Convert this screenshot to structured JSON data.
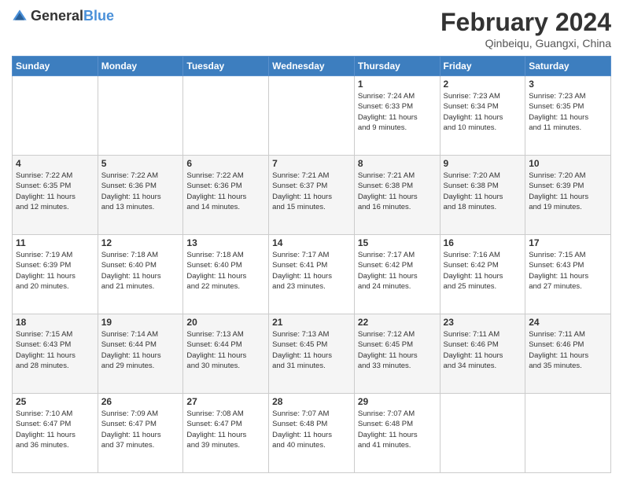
{
  "header": {
    "logo_general": "General",
    "logo_blue": "Blue",
    "month_title": "February 2024",
    "location": "Qinbeiqu, Guangxi, China"
  },
  "weekdays": [
    "Sunday",
    "Monday",
    "Tuesday",
    "Wednesday",
    "Thursday",
    "Friday",
    "Saturday"
  ],
  "weeks": [
    [
      {
        "day": "",
        "info": ""
      },
      {
        "day": "",
        "info": ""
      },
      {
        "day": "",
        "info": ""
      },
      {
        "day": "",
        "info": ""
      },
      {
        "day": "1",
        "info": "Sunrise: 7:24 AM\nSunset: 6:33 PM\nDaylight: 11 hours\nand 9 minutes."
      },
      {
        "day": "2",
        "info": "Sunrise: 7:23 AM\nSunset: 6:34 PM\nDaylight: 11 hours\nand 10 minutes."
      },
      {
        "day": "3",
        "info": "Sunrise: 7:23 AM\nSunset: 6:35 PM\nDaylight: 11 hours\nand 11 minutes."
      }
    ],
    [
      {
        "day": "4",
        "info": "Sunrise: 7:22 AM\nSunset: 6:35 PM\nDaylight: 11 hours\nand 12 minutes."
      },
      {
        "day": "5",
        "info": "Sunrise: 7:22 AM\nSunset: 6:36 PM\nDaylight: 11 hours\nand 13 minutes."
      },
      {
        "day": "6",
        "info": "Sunrise: 7:22 AM\nSunset: 6:36 PM\nDaylight: 11 hours\nand 14 minutes."
      },
      {
        "day": "7",
        "info": "Sunrise: 7:21 AM\nSunset: 6:37 PM\nDaylight: 11 hours\nand 15 minutes."
      },
      {
        "day": "8",
        "info": "Sunrise: 7:21 AM\nSunset: 6:38 PM\nDaylight: 11 hours\nand 16 minutes."
      },
      {
        "day": "9",
        "info": "Sunrise: 7:20 AM\nSunset: 6:38 PM\nDaylight: 11 hours\nand 18 minutes."
      },
      {
        "day": "10",
        "info": "Sunrise: 7:20 AM\nSunset: 6:39 PM\nDaylight: 11 hours\nand 19 minutes."
      }
    ],
    [
      {
        "day": "11",
        "info": "Sunrise: 7:19 AM\nSunset: 6:39 PM\nDaylight: 11 hours\nand 20 minutes."
      },
      {
        "day": "12",
        "info": "Sunrise: 7:18 AM\nSunset: 6:40 PM\nDaylight: 11 hours\nand 21 minutes."
      },
      {
        "day": "13",
        "info": "Sunrise: 7:18 AM\nSunset: 6:40 PM\nDaylight: 11 hours\nand 22 minutes."
      },
      {
        "day": "14",
        "info": "Sunrise: 7:17 AM\nSunset: 6:41 PM\nDaylight: 11 hours\nand 23 minutes."
      },
      {
        "day": "15",
        "info": "Sunrise: 7:17 AM\nSunset: 6:42 PM\nDaylight: 11 hours\nand 24 minutes."
      },
      {
        "day": "16",
        "info": "Sunrise: 7:16 AM\nSunset: 6:42 PM\nDaylight: 11 hours\nand 25 minutes."
      },
      {
        "day": "17",
        "info": "Sunrise: 7:15 AM\nSunset: 6:43 PM\nDaylight: 11 hours\nand 27 minutes."
      }
    ],
    [
      {
        "day": "18",
        "info": "Sunrise: 7:15 AM\nSunset: 6:43 PM\nDaylight: 11 hours\nand 28 minutes."
      },
      {
        "day": "19",
        "info": "Sunrise: 7:14 AM\nSunset: 6:44 PM\nDaylight: 11 hours\nand 29 minutes."
      },
      {
        "day": "20",
        "info": "Sunrise: 7:13 AM\nSunset: 6:44 PM\nDaylight: 11 hours\nand 30 minutes."
      },
      {
        "day": "21",
        "info": "Sunrise: 7:13 AM\nSunset: 6:45 PM\nDaylight: 11 hours\nand 31 minutes."
      },
      {
        "day": "22",
        "info": "Sunrise: 7:12 AM\nSunset: 6:45 PM\nDaylight: 11 hours\nand 33 minutes."
      },
      {
        "day": "23",
        "info": "Sunrise: 7:11 AM\nSunset: 6:46 PM\nDaylight: 11 hours\nand 34 minutes."
      },
      {
        "day": "24",
        "info": "Sunrise: 7:11 AM\nSunset: 6:46 PM\nDaylight: 11 hours\nand 35 minutes."
      }
    ],
    [
      {
        "day": "25",
        "info": "Sunrise: 7:10 AM\nSunset: 6:47 PM\nDaylight: 11 hours\nand 36 minutes."
      },
      {
        "day": "26",
        "info": "Sunrise: 7:09 AM\nSunset: 6:47 PM\nDaylight: 11 hours\nand 37 minutes."
      },
      {
        "day": "27",
        "info": "Sunrise: 7:08 AM\nSunset: 6:47 PM\nDaylight: 11 hours\nand 39 minutes."
      },
      {
        "day": "28",
        "info": "Sunrise: 7:07 AM\nSunset: 6:48 PM\nDaylight: 11 hours\nand 40 minutes."
      },
      {
        "day": "29",
        "info": "Sunrise: 7:07 AM\nSunset: 6:48 PM\nDaylight: 11 hours\nand 41 minutes."
      },
      {
        "day": "",
        "info": ""
      },
      {
        "day": "",
        "info": ""
      }
    ]
  ]
}
